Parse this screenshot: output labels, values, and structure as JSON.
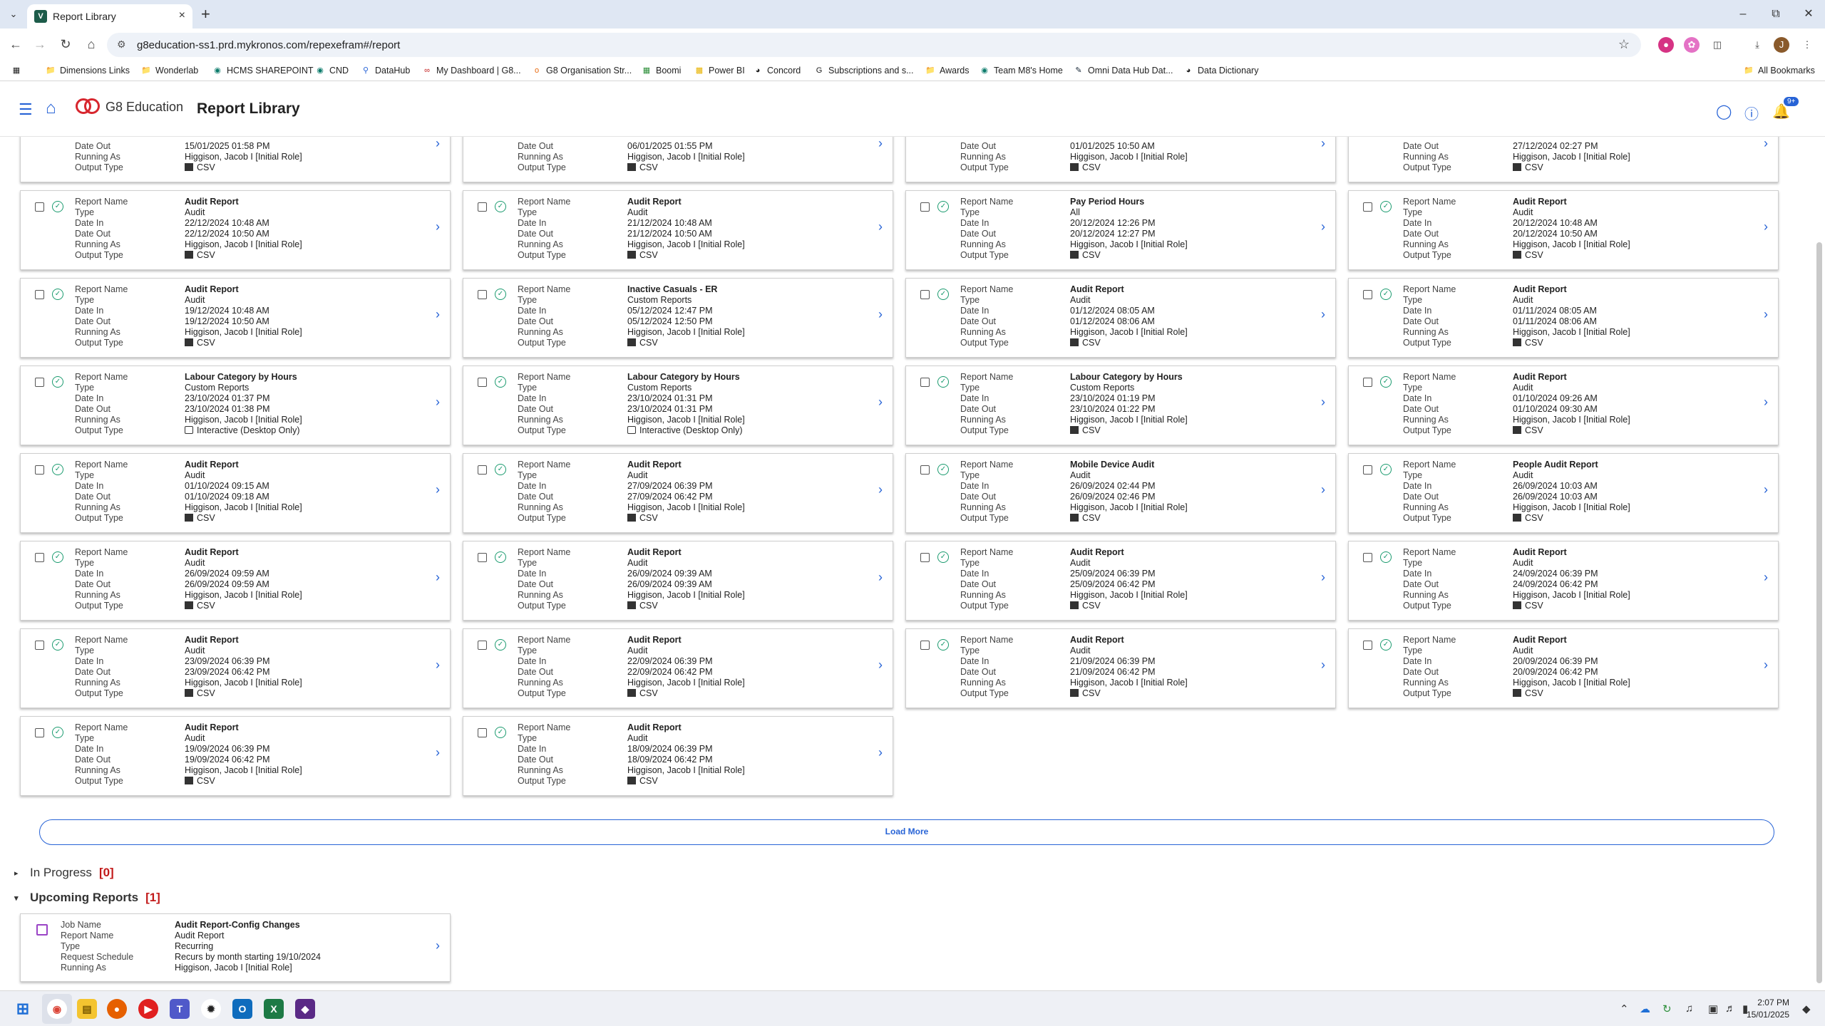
{
  "browser": {
    "tab_title": "Report Library",
    "tab_favicon": "V",
    "url": "g8education-ss1.prd.mykronos.com/repexefram#/report",
    "bookmarks": [
      "Dimensions Links",
      "Wonderlab",
      "HCMS SHAREPOINT",
      "CND",
      "DataHub",
      "My Dashboard | G8...",
      "G8 Organisation Str...",
      "Boomi",
      "Power BI",
      "Concord",
      "Subscriptions and s...",
      "Awards",
      "Team M8's Home",
      "Omni Data Hub Dat...",
      "Data Dictionary"
    ],
    "all_bookmarks": "All Bookmarks",
    "profile_initial": "J"
  },
  "app": {
    "logo_text": "G8 Education",
    "title": "Report Library",
    "notification_count": "9+"
  },
  "labels": {
    "report_name": "Report Name",
    "type": "Type",
    "date_in": "Date In",
    "date_out": "Date Out",
    "running_as": "Running As",
    "output_type": "Output Type"
  },
  "top_partial": [
    {
      "date_out": "15/01/2025 01:58 PM",
      "running_as": "Higgison, Jacob I [Initial Role]",
      "output": "CSV"
    },
    {
      "date_out": "06/01/2025 01:55 PM",
      "running_as": "Higgison, Jacob I [Initial Role]",
      "output": "CSV"
    },
    {
      "date_out": "01/01/2025 10:50 AM",
      "running_as": "Higgison, Jacob I [Initial Role]",
      "output": "CSV"
    },
    {
      "date_out": "27/12/2024 02:27 PM",
      "running_as": "Higgison, Jacob I [Initial Role]",
      "output": "CSV"
    }
  ],
  "reports": [
    {
      "name": "Audit Report",
      "type": "Audit",
      "date_in": "22/12/2024 10:48 AM",
      "date_out": "22/12/2024 10:50 AM",
      "running_as": "Higgison, Jacob I [Initial Role]",
      "output": "CSV"
    },
    {
      "name": "Audit Report",
      "type": "Audit",
      "date_in": "21/12/2024 10:48 AM",
      "date_out": "21/12/2024 10:50 AM",
      "running_as": "Higgison, Jacob I [Initial Role]",
      "output": "CSV"
    },
    {
      "name": "Pay Period Hours",
      "type": "All",
      "date_in": "20/12/2024 12:26 PM",
      "date_out": "20/12/2024 12:27 PM",
      "running_as": "Higgison, Jacob I [Initial Role]",
      "output": "CSV"
    },
    {
      "name": "Audit Report",
      "type": "Audit",
      "date_in": "20/12/2024 10:48 AM",
      "date_out": "20/12/2024 10:50 AM",
      "running_as": "Higgison, Jacob I [Initial Role]",
      "output": "CSV"
    },
    {
      "name": "Audit Report",
      "type": "Audit",
      "date_in": "19/12/2024 10:48 AM",
      "date_out": "19/12/2024 10:50 AM",
      "running_as": "Higgison, Jacob I [Initial Role]",
      "output": "CSV"
    },
    {
      "name": "Inactive Casuals - ER",
      "type": "Custom Reports",
      "date_in": "05/12/2024 12:47 PM",
      "date_out": "05/12/2024 12:50 PM",
      "running_as": "Higgison, Jacob I [Initial Role]",
      "output": "CSV"
    },
    {
      "name": "Audit Report",
      "type": "Audit",
      "date_in": "01/12/2024 08:05 AM",
      "date_out": "01/12/2024 08:06 AM",
      "running_as": "Higgison, Jacob I [Initial Role]",
      "output": "CSV"
    },
    {
      "name": "Audit Report",
      "type": "Audit",
      "date_in": "01/11/2024 08:05 AM",
      "date_out": "01/11/2024 08:06 AM",
      "running_as": "Higgison, Jacob I [Initial Role]",
      "output": "CSV"
    },
    {
      "name": "Labour Category by Hours",
      "type": "Custom Reports",
      "date_in": "23/10/2024 01:37 PM",
      "date_out": "23/10/2024 01:38 PM",
      "running_as": "Higgison, Jacob I [Initial Role]",
      "output": "Interactive (Desktop Only)"
    },
    {
      "name": "Labour Category by Hours",
      "type": "Custom Reports",
      "date_in": "23/10/2024 01:31 PM",
      "date_out": "23/10/2024 01:31 PM",
      "running_as": "Higgison, Jacob I [Initial Role]",
      "output": "Interactive (Desktop Only)"
    },
    {
      "name": "Labour Category by Hours",
      "type": "Custom Reports",
      "date_in": "23/10/2024 01:19 PM",
      "date_out": "23/10/2024 01:22 PM",
      "running_as": "Higgison, Jacob I [Initial Role]",
      "output": "CSV"
    },
    {
      "name": "Audit Report",
      "type": "Audit",
      "date_in": "01/10/2024 09:26 AM",
      "date_out": "01/10/2024 09:30 AM",
      "running_as": "Higgison, Jacob I [Initial Role]",
      "output": "CSV"
    },
    {
      "name": "Audit Report",
      "type": "Audit",
      "date_in": "01/10/2024 09:15 AM",
      "date_out": "01/10/2024 09:18 AM",
      "running_as": "Higgison, Jacob I [Initial Role]",
      "output": "CSV"
    },
    {
      "name": "Audit Report",
      "type": "Audit",
      "date_in": "27/09/2024 06:39 PM",
      "date_out": "27/09/2024 06:42 PM",
      "running_as": "Higgison, Jacob I [Initial Role]",
      "output": "CSV"
    },
    {
      "name": "Mobile Device Audit",
      "type": "Audit",
      "date_in": "26/09/2024 02:44 PM",
      "date_out": "26/09/2024 02:46 PM",
      "running_as": "Higgison, Jacob I [Initial Role]",
      "output": "CSV"
    },
    {
      "name": "People Audit Report",
      "type": "Audit",
      "date_in": "26/09/2024 10:03 AM",
      "date_out": "26/09/2024 10:03 AM",
      "running_as": "Higgison, Jacob I [Initial Role]",
      "output": "CSV"
    },
    {
      "name": "Audit Report",
      "type": "Audit",
      "date_in": "26/09/2024 09:59 AM",
      "date_out": "26/09/2024 09:59 AM",
      "running_as": "Higgison, Jacob I [Initial Role]",
      "output": "CSV"
    },
    {
      "name": "Audit Report",
      "type": "Audit",
      "date_in": "26/09/2024 09:39 AM",
      "date_out": "26/09/2024 09:39 AM",
      "running_as": "Higgison, Jacob I [Initial Role]",
      "output": "CSV"
    },
    {
      "name": "Audit Report",
      "type": "Audit",
      "date_in": "25/09/2024 06:39 PM",
      "date_out": "25/09/2024 06:42 PM",
      "running_as": "Higgison, Jacob I [Initial Role]",
      "output": "CSV"
    },
    {
      "name": "Audit Report",
      "type": "Audit",
      "date_in": "24/09/2024 06:39 PM",
      "date_out": "24/09/2024 06:42 PM",
      "running_as": "Higgison, Jacob I [Initial Role]",
      "output": "CSV"
    },
    {
      "name": "Audit Report",
      "type": "Audit",
      "date_in": "23/09/2024 06:39 PM",
      "date_out": "23/09/2024 06:42 PM",
      "running_as": "Higgison, Jacob I [Initial Role]",
      "output": "CSV"
    },
    {
      "name": "Audit Report",
      "type": "Audit",
      "date_in": "22/09/2024 06:39 PM",
      "date_out": "22/09/2024 06:42 PM",
      "running_as": "Higgison, Jacob I [Initial Role]",
      "output": "CSV"
    },
    {
      "name": "Audit Report",
      "type": "Audit",
      "date_in": "21/09/2024 06:39 PM",
      "date_out": "21/09/2024 06:42 PM",
      "running_as": "Higgison, Jacob I [Initial Role]",
      "output": "CSV"
    },
    {
      "name": "Audit Report",
      "type": "Audit",
      "date_in": "20/09/2024 06:39 PM",
      "date_out": "20/09/2024 06:42 PM",
      "running_as": "Higgison, Jacob I [Initial Role]",
      "output": "CSV"
    },
    {
      "name": "Audit Report",
      "type": "Audit",
      "date_in": "19/09/2024 06:39 PM",
      "date_out": "19/09/2024 06:42 PM",
      "running_as": "Higgison, Jacob I [Initial Role]",
      "output": "CSV"
    },
    {
      "name": "Audit Report",
      "type": "Audit",
      "date_in": "18/09/2024 06:39 PM",
      "date_out": "18/09/2024 06:42 PM",
      "running_as": "Higgison, Jacob I [Initial Role]",
      "output": "CSV"
    }
  ],
  "load_more": "Load More",
  "in_progress": {
    "label": "In Progress",
    "count": "[0]"
  },
  "upcoming": {
    "label": "Upcoming Reports",
    "count": "[1]"
  },
  "upcoming_labels": {
    "job_name": "Job Name",
    "report_name": "Report Name",
    "type": "Type",
    "request_schedule": "Request Schedule",
    "running_as": "Running As"
  },
  "upcoming_job": {
    "job_name": "Audit Report-Config Changes",
    "report_name": "Audit Report",
    "type": "Recurring",
    "request_schedule": "Recurs by month starting 19/10/2024",
    "running_as": "Higgison, Jacob I [Initial Role]"
  },
  "taskbar": {
    "time": "2:07 PM",
    "date": "15/01/2025"
  },
  "colors": {
    "accent": "#2763d6",
    "success": "#1b9b6f",
    "count_red": "#c21a1a",
    "brand_red": "#d7262e"
  }
}
